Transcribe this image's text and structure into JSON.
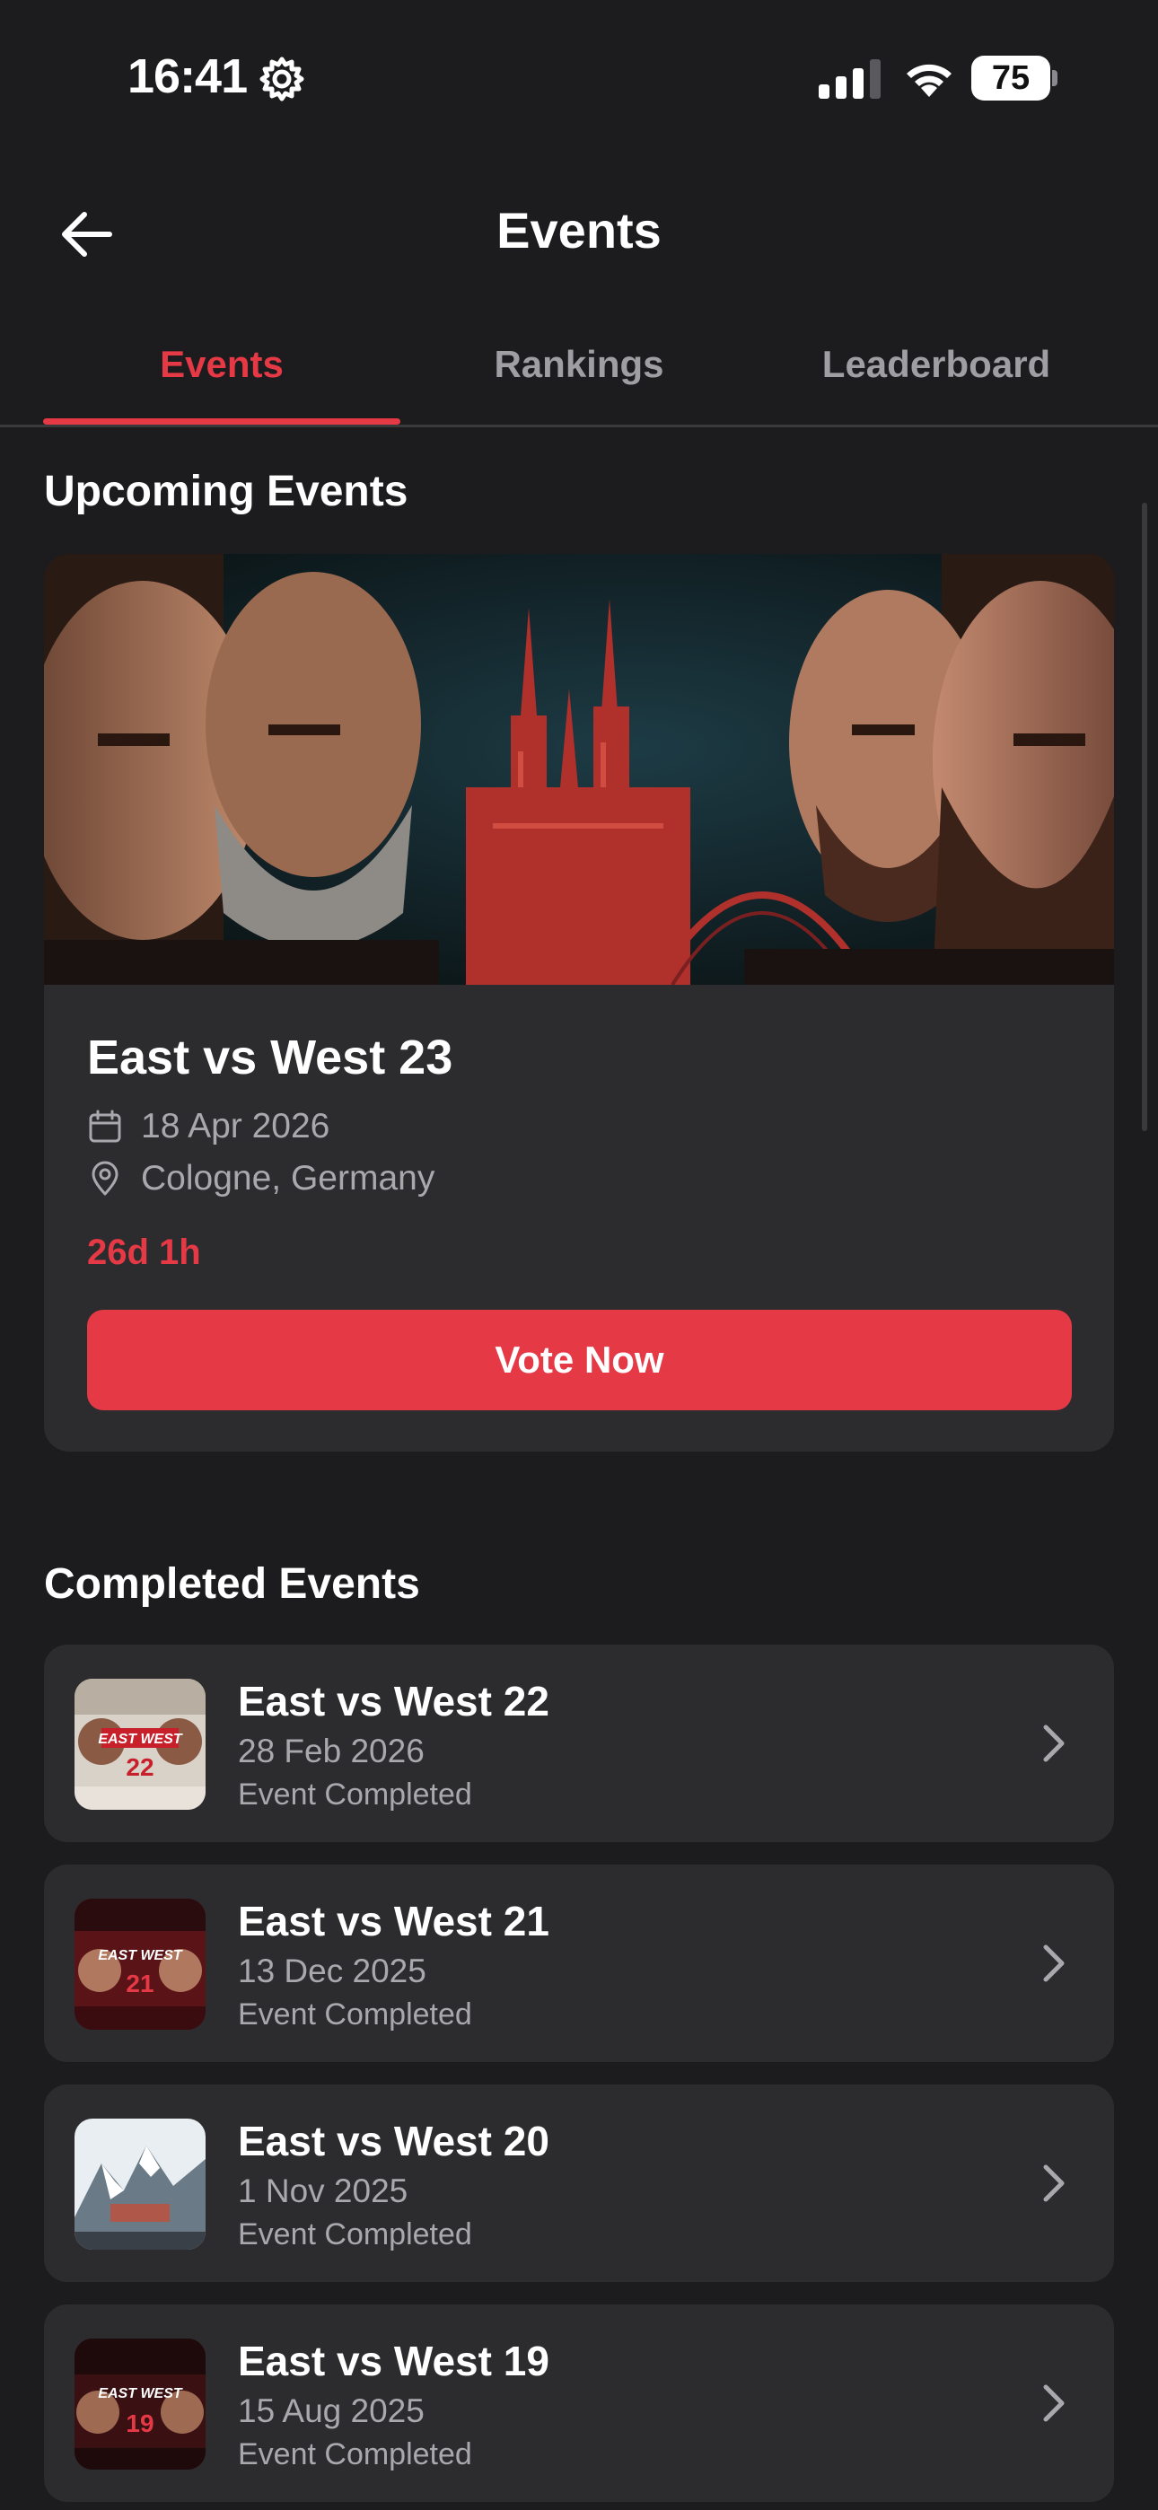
{
  "status_bar": {
    "time": "16:41",
    "battery": "75",
    "icons": [
      "gear-icon",
      "signal-icon",
      "wifi-icon",
      "battery-icon"
    ]
  },
  "header": {
    "title": "Events",
    "back_icon": "arrow-left-icon"
  },
  "tabs": [
    {
      "label": "Events",
      "active": true
    },
    {
      "label": "Rankings",
      "active": false
    },
    {
      "label": "Leaderboard",
      "active": false
    }
  ],
  "upcoming": {
    "section_title": "Upcoming Events",
    "event": {
      "title": "East vs West 23",
      "date": "18 Apr 2026",
      "location": "Cologne, Germany",
      "countdown": "26d 1h",
      "button_label": "Vote Now",
      "date_icon": "calendar-icon",
      "location_icon": "map-pin-icon"
    }
  },
  "completed": {
    "section_title": "Completed Events",
    "events": [
      {
        "name": "East vs West 22",
        "date": "28 Feb 2026",
        "status": "Event Completed",
        "thumb_badge": "22"
      },
      {
        "name": "East vs West 21",
        "date": "13 Dec 2025",
        "status": "Event Completed",
        "thumb_badge": "21"
      },
      {
        "name": "East vs West 20",
        "date": "1 Nov 2025",
        "status": "Event Completed",
        "thumb_badge": ""
      },
      {
        "name": "East vs West 19",
        "date": "15 Aug 2025",
        "status": "Event Completed",
        "thumb_badge": "19"
      }
    ]
  },
  "colors": {
    "background": "#1c1c1e",
    "card": "#2c2c2e",
    "accent": "#e63946",
    "muted_text": "#a8a8ad",
    "tab_inactive": "#9e9ea3"
  }
}
